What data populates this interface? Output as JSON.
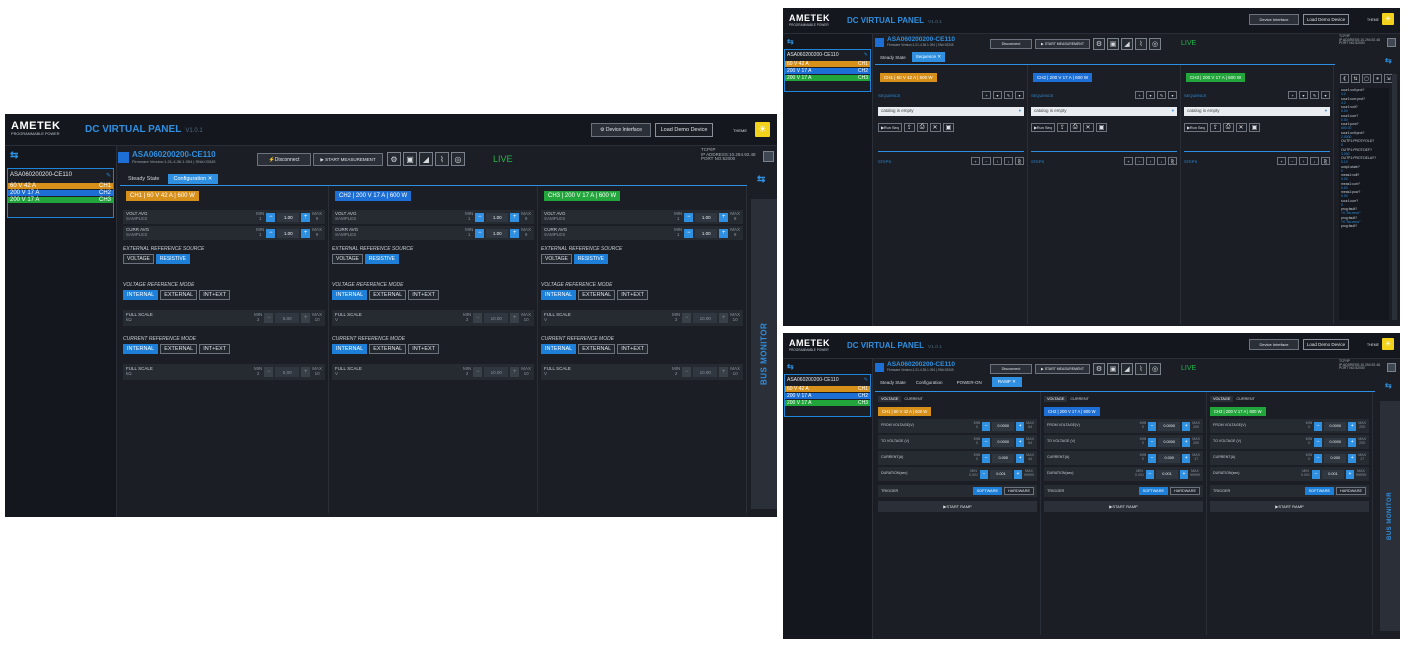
{
  "common": {
    "logo": "AMETEK",
    "logo_sub": "PROGRAMMABLE POWER",
    "app_title": "DC VIRTUAL PANEL",
    "app_version": "V1.0.1",
    "device_interface": "Device Interface",
    "load_demo": "Load Demo Device",
    "theme": "THEME",
    "device_name": "ASA060200200-CE110",
    "firmware": "Firmware Version:1.01-4.36.1.094 | SN#:03345",
    "disconnect": "Disconnect",
    "start_measurement": "START MEASUREMENT",
    "live": "LIVE",
    "tcpip": "TCP/IP",
    "ip": "IP ADDRESS:10.294.92.48",
    "port": "PORT NO:52000",
    "bus_monitor": "BUS MONITOR",
    "ch_list": [
      {
        "label": "60 V 42 A",
        "tag": "CH1"
      },
      {
        "label": "200 V 17 A",
        "tag": "CH2"
      },
      {
        "label": "200 V 17 A",
        "tag": "CH3"
      }
    ],
    "channels": [
      "CH1 | 60 V 42 A | 600 W",
      "CH2 | 200 V 17 A | 600 W",
      "CH3 | 200 V 17 A | 600 W"
    ],
    "colors": {
      "accent": "#2f8fe0",
      "ch1": "#d7901a",
      "ch2": "#1d6fd6",
      "ch3": "#22a53a",
      "live": "#22b84a"
    }
  },
  "config": {
    "tabs": [
      "Steady State",
      "Configuration"
    ],
    "active_tab": "Configuration",
    "volt_avg": "VOLT AVG",
    "curr_avg": "CURR AVG",
    "samples": "SAMPLES",
    "min": "MIN",
    "max": "MAX",
    "min_val": "1",
    "max_val": "9",
    "avg_value": "1.00",
    "ext_ref": "EXTERNAL REFERENCE SOURCE",
    "voltage": "VOLTAGE",
    "resistive": "RESISTIVE",
    "volt_ref_mode": "VOLTAGE REFERENCE MODE",
    "curr_ref_mode": "CURRENT REFERENCE MODE",
    "internal": "INTERNAL",
    "external": "EXTERNAL",
    "int_ext": "INT+EXT",
    "full_scale": "FULL SCALE",
    "fs": [
      {
        "unit": "kΩ",
        "min": "2",
        "val": "5.00",
        "max": "10",
        "cur_min": "2",
        "cur_val": "5.00",
        "cur_max": "10"
      },
      {
        "unit": "V",
        "min": "2",
        "val": "10.00",
        "max": "10",
        "cur_min": "2",
        "cur_val": "10.00",
        "cur_max": "10"
      },
      {
        "unit": "V",
        "min": "2",
        "val": "10.00",
        "max": "10",
        "cur_min": "2",
        "cur_val": "10.00",
        "cur_max": "10"
      }
    ]
  },
  "sequence": {
    "tabs": [
      "Steady State",
      "Sequence"
    ],
    "active_tab": "Sequence",
    "sequence_label": "SEQUENCE",
    "catalog": "catalog is empty",
    "run_seq": "Run Seq",
    "steps": "STEPS",
    "bus_items": [
      {
        "t": "sour1:volt:prot?",
        "v": false
      },
      {
        "t": "4.2",
        "v": true
      },
      {
        "t": "sour1:curr:prot?",
        "v": false
      },
      {
        "t": "4.2",
        "v": true
      },
      {
        "t": "sour1:volt?",
        "v": false
      },
      {
        "t": "0.00",
        "v": true
      },
      {
        "t": "sour1:curr?",
        "v": false
      },
      {
        "t": "0.00",
        "v": true
      },
      {
        "t": "sour1:pow?",
        "v": false
      },
      {
        "t": "600.00",
        "v": true
      },
      {
        "t": "sour1:ovlt:prot?",
        "v": false
      },
      {
        "t": "2.0000",
        "v": true
      },
      {
        "t": "OUTP1:PROT:FOLD?",
        "v": false
      },
      {
        "t": "0",
        "v": true
      },
      {
        "t": "OUTP1:PROT:DEF?",
        "v": false
      },
      {
        "t": "3.000",
        "v": true
      },
      {
        "t": "OUTP1:PROT:DELAY?",
        "v": false
      },
      {
        "t": "0.10",
        "v": true
      },
      {
        "t": "outp1:state?",
        "v": false
      },
      {
        "t": "0",
        "v": true
      },
      {
        "t": "meas1:volt?",
        "v": false
      },
      {
        "t": "0.00",
        "v": true
      },
      {
        "t": "meas1:curr?",
        "v": false
      },
      {
        "t": "0.00",
        "v": true
      },
      {
        "t": "meas1:pow?",
        "v": false
      },
      {
        "t": "0.00",
        "v": true
      },
      {
        "t": "sour1:curr?",
        "v": false
      },
      {
        "t": "0",
        "v": true
      },
      {
        "t": "prog:fault?",
        "v": false
      },
      {
        "t": "+0,\"No error\"",
        "v": true
      },
      {
        "t": "prog:fault?",
        "v": false
      },
      {
        "t": "+0,\"No error\"",
        "v": true
      },
      {
        "t": "prog:fault?",
        "v": false
      }
    ]
  },
  "ramp": {
    "tabs": [
      "Steady State",
      "Configuration",
      "POWER-ON",
      "RAMP"
    ],
    "active_tab": "RAMP",
    "voltage": "VOLTAGE",
    "current": "CURRENT",
    "from_voltage": "FROM VOLTAGE(V)",
    "to_voltage": "TO VOLTAGE (V)",
    "current_a": "CURRENT(A)",
    "duration": "DURATION(sec)",
    "trigger": "TRIGGER",
    "software": "SOFTWARE",
    "hardware": "HARDWARE",
    "start_ramp": "START RAMP",
    "min": "MIN",
    "max": "MAX",
    "cols": [
      {
        "from_min": "0",
        "from_val": "0.0000",
        "from_max": "64",
        "to_min": "0",
        "to_val": "0.0000",
        "to_max": "64",
        "cur_min": "0",
        "cur_val": "0.000",
        "cur_max": "44",
        "dur_min": "0.001",
        "dur_val": "0.001",
        "dur_max": "99999"
      },
      {
        "from_min": "0",
        "from_val": "0.0000",
        "from_max": "200",
        "to_min": "0",
        "to_val": "0.0000",
        "to_max": "200",
        "cur_min": "0",
        "cur_val": "0.000",
        "cur_max": "17",
        "dur_min": "0.001",
        "dur_val": "0.001",
        "dur_max": "99999"
      },
      {
        "from_min": "0",
        "from_val": "0.0000",
        "from_max": "200",
        "to_min": "0",
        "to_val": "0.0000",
        "to_max": "200",
        "cur_min": "0",
        "cur_val": "0.000",
        "cur_max": "17",
        "dur_min": "0.001",
        "dur_val": "0.001",
        "dur_max": "99999"
      }
    ]
  }
}
